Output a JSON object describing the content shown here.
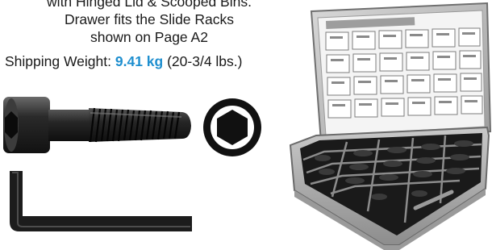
{
  "caption": {
    "line1": "with Hinged Lid & Scooped Bins.",
    "line2": "Drawer fits the Slide Racks",
    "line3": "shown on Page A2"
  },
  "shipping": {
    "label": "Shipping Weight:",
    "metric": "9.41 kg",
    "imperial": "(20-3/4 lbs.)"
  },
  "colors": {
    "accent": "#1f8fcf",
    "text": "#1a1a1a",
    "hardware_black": "#1c1c1c",
    "drawer_gray": "#b7b7b7"
  },
  "images": {
    "screw": "socket-head-cap-screw",
    "hex_end": "hex-socket-end-view",
    "key": "hex-key-wrench",
    "drawer": "metal-drawer-assortment-kit"
  }
}
